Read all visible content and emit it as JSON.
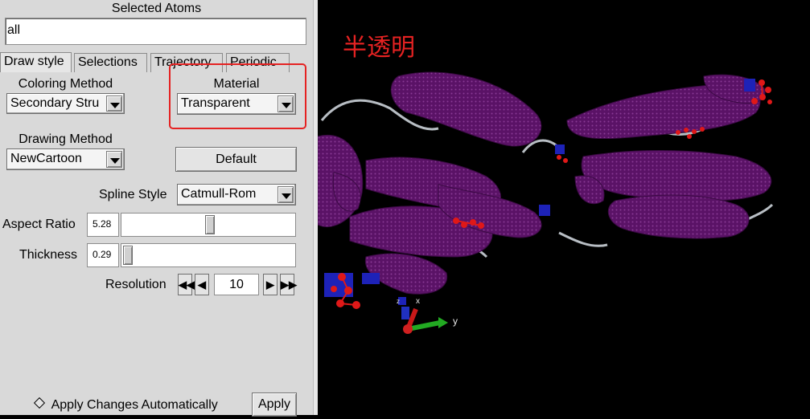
{
  "panel": {
    "selected_atoms_label": "Selected Atoms",
    "selected_atoms_value": "all",
    "tabs": [
      {
        "label": "Draw style",
        "active": true
      },
      {
        "label": "Selections",
        "active": false
      },
      {
        "label": "Trajectory",
        "active": false
      },
      {
        "label": "Periodic",
        "active": false
      }
    ],
    "coloring_method": {
      "label": "Coloring Method",
      "value": "Secondary Stru"
    },
    "material": {
      "label": "Material",
      "value": "Transparent"
    },
    "drawing_method": {
      "label": "Drawing Method",
      "value": "NewCartoon"
    },
    "default_button": "Default",
    "spline_style": {
      "label": "Spline Style",
      "value": "Catmull-Rom"
    },
    "aspect_ratio": {
      "label": "Aspect Ratio",
      "value": "5.28",
      "slider_fraction": 0.51
    },
    "thickness": {
      "label": "Thickness",
      "value": "0.29",
      "slider_fraction": 0.0
    },
    "resolution": {
      "label": "Resolution",
      "value": "10"
    },
    "apply_auto_label": "Apply Changes Automatically",
    "apply_button": "Apply"
  },
  "viewport": {
    "annotation": "半透明",
    "axes": {
      "x_label": "x",
      "y_label": "y",
      "z_label": "z"
    }
  },
  "colors": {
    "annotation_red": "#e52222",
    "protein_purple": "#6b1a78",
    "viewport_bg": "#000000",
    "atom_red": "#e01818",
    "atom_blue": "#1d22b8"
  }
}
